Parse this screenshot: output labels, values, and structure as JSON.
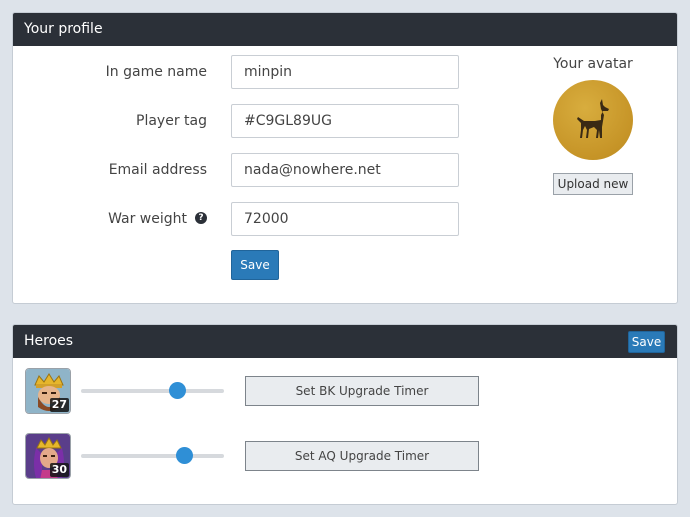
{
  "profile": {
    "header": "Your profile",
    "fields": [
      {
        "label": "In game name",
        "value": "minpin"
      },
      {
        "label": "Player tag",
        "value": "#C9GL89UG"
      },
      {
        "label": "Email address",
        "value": "nada@nowhere.net"
      },
      {
        "label": "War weight",
        "value": "72000"
      }
    ],
    "help_icon": "question-circle-icon",
    "save_label": "Save",
    "avatar_title": "Your avatar",
    "avatar_icon": "doberman-silhouette-icon",
    "upload_label": "Upload new"
  },
  "heroes": {
    "header": "Heroes",
    "save_label": "Save",
    "items": [
      {
        "level": "27",
        "slider_value": 0.67,
        "timer_label": "Set BK Upgrade Timer",
        "icon": "barbarian-king-icon"
      },
      {
        "level": "30",
        "slider_value": 0.72,
        "timer_label": "Set AQ Upgrade Timer",
        "icon": "archer-queen-icon"
      }
    ]
  },
  "colors": {
    "header_bg": "#2b3038",
    "accent": "#2a7ab8",
    "slider": "#2f8fd6",
    "avatar": "#c69427"
  }
}
